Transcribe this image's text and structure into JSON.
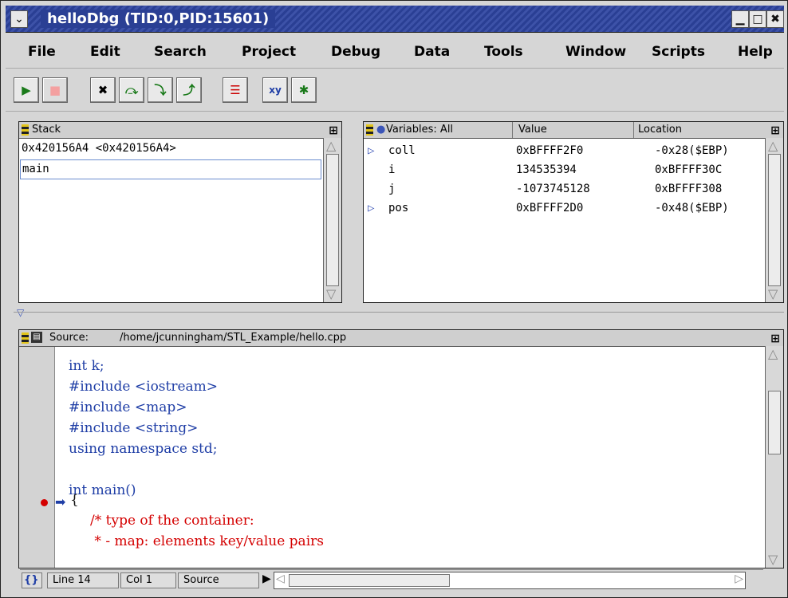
{
  "window": {
    "title": "helloDbg (TID:0,PID:15601)",
    "menu_icon": "chevron-down-icon",
    "buttons": [
      "minimize-icon",
      "maximize-icon",
      "close-icon"
    ]
  },
  "menubar": {
    "items": [
      "File",
      "Edit",
      "Search",
      "Project",
      "Debug",
      "Data",
      "Tools",
      "Window",
      "Scripts",
      "Help"
    ]
  },
  "toolbar": {
    "buttons": [
      {
        "name": "run-icon",
        "glyph": "▶"
      },
      {
        "name": "stop-icon",
        "glyph": "■"
      },
      {
        "name": "kill-icon",
        "glyph": "✖"
      },
      {
        "name": "step-over-icon",
        "glyph": "⤼"
      },
      {
        "name": "step-into-icon",
        "glyph": "⤵"
      },
      {
        "name": "step-out-icon",
        "glyph": "⤴"
      },
      {
        "name": "list-icon",
        "glyph": "☰"
      },
      {
        "name": "xy-plot-icon",
        "glyph": "xy"
      },
      {
        "name": "bug-icon",
        "glyph": "✱"
      }
    ]
  },
  "stack": {
    "header": "Stack",
    "frames": [
      "0x420156A4 <0x420156A4>",
      "main"
    ]
  },
  "variables": {
    "header": "Variables: All",
    "columns": [
      "Value",
      "Location"
    ],
    "rows": [
      {
        "name": "coll",
        "value": "0xBFFFF2F0",
        "location": "-0x28($EBP)",
        "expandable": true
      },
      {
        "name": "i",
        "value": "134535394",
        "location": "0xBFFFF30C",
        "expandable": false
      },
      {
        "name": "j",
        "value": "-1073745128",
        "location": "0xBFFFF308",
        "expandable": false
      },
      {
        "name": "pos",
        "value": "0xBFFFF2D0",
        "location": "-0x48($EBP)",
        "expandable": true
      }
    ]
  },
  "source": {
    "label": "Source:",
    "path": "/home/jcunningham/STL_Example/hello.cpp",
    "lines": {
      "l1": "int k;",
      "l2": "#include <iostream>",
      "l3": "#include <map>",
      "l4": "#include <string>",
      "l5": "using namespace std;",
      "l6": "",
      "l7": "int main()",
      "l8": "{",
      "l9": "     /* type of the container:",
      "l10": "      * - map: elements key/value pairs"
    },
    "colors": {
      "keyword": "#1f3ea6",
      "comment": "#d40000",
      "breakpoint": "#d40000"
    }
  },
  "statusbar": {
    "braces": "{}",
    "line": "Line 14",
    "col": "Col 1",
    "mode": "Source"
  }
}
